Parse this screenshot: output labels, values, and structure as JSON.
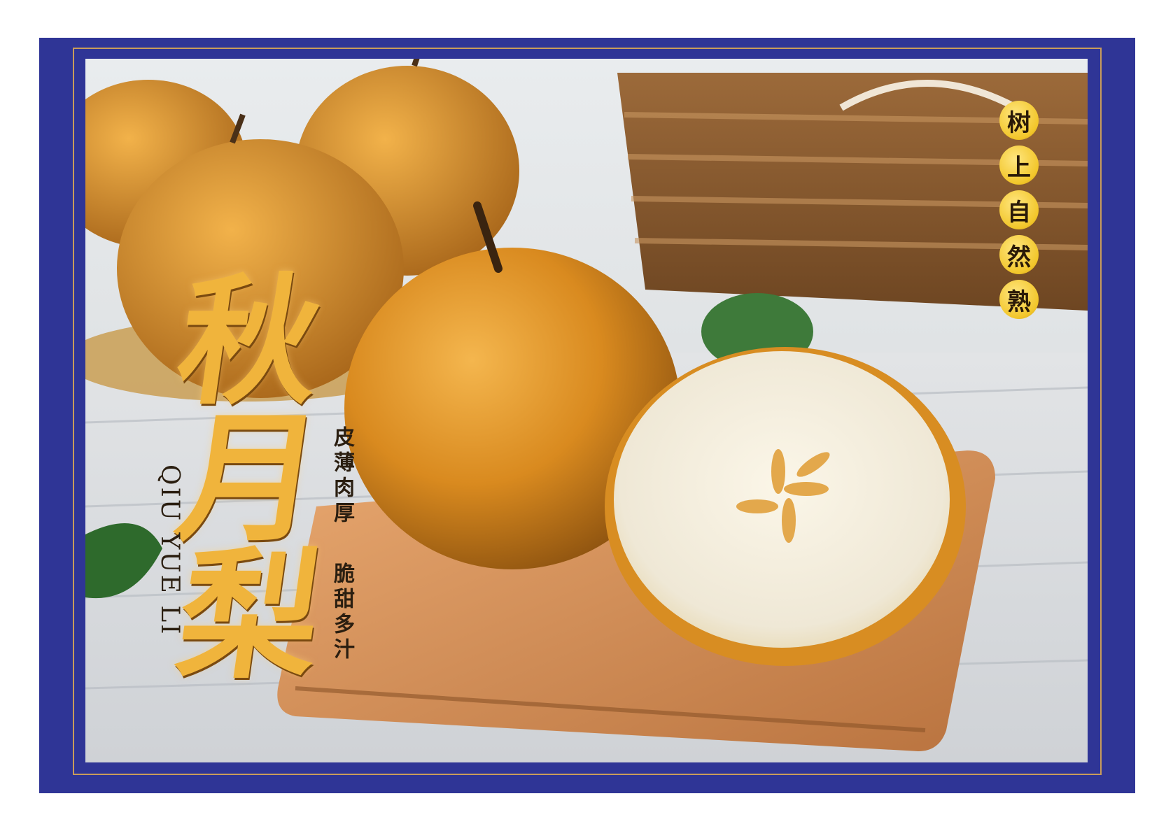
{
  "product": {
    "title_chars": [
      "秋",
      "月",
      "梨"
    ],
    "pinyin": "QIU YUE LI",
    "tagline_1": "皮薄肉厚",
    "tagline_2": "脆甜多汁",
    "badge_chars": [
      "树",
      "上",
      "自",
      "然",
      "熟"
    ]
  },
  "colors": {
    "box_blue": "#2f3596",
    "gold_border": "#c99c5a",
    "title_gold": "#f0b43c",
    "badge_yellow": "#f2c62a",
    "pear_skin": "#d98a1f",
    "pear_flesh": "#f3efe2"
  }
}
